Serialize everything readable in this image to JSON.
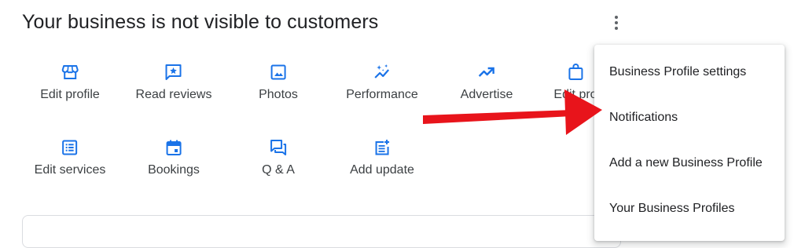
{
  "header": {
    "title": "Your business is not visible to customers",
    "more_icon": "more-vert-icon"
  },
  "actions": [
    {
      "label": "Edit profile",
      "icon": "storefront-icon"
    },
    {
      "label": "Read reviews",
      "icon": "star-review-icon"
    },
    {
      "label": "Photos",
      "icon": "photo-icon"
    },
    {
      "label": "Performance",
      "icon": "sparkle-trend-icon"
    },
    {
      "label": "Advertise",
      "icon": "trending-up-icon"
    },
    {
      "label": "Edit pro",
      "icon": "shopping-bag-icon"
    },
    {
      "label": "Edit services",
      "icon": "list-icon"
    },
    {
      "label": "Bookings",
      "icon": "calendar-icon"
    },
    {
      "label": "Q & A",
      "icon": "forum-icon"
    },
    {
      "label": "Add update",
      "icon": "post-add-icon"
    }
  ],
  "menu": {
    "items": [
      {
        "label": "Business Profile settings"
      },
      {
        "label": "Notifications"
      },
      {
        "label": "Add a new Business Profile"
      },
      {
        "label": "Your Business Profiles"
      }
    ]
  },
  "colors": {
    "icon_blue": "#1a73e8",
    "annotation_arrow": "#e8141b",
    "text": "#202124"
  }
}
